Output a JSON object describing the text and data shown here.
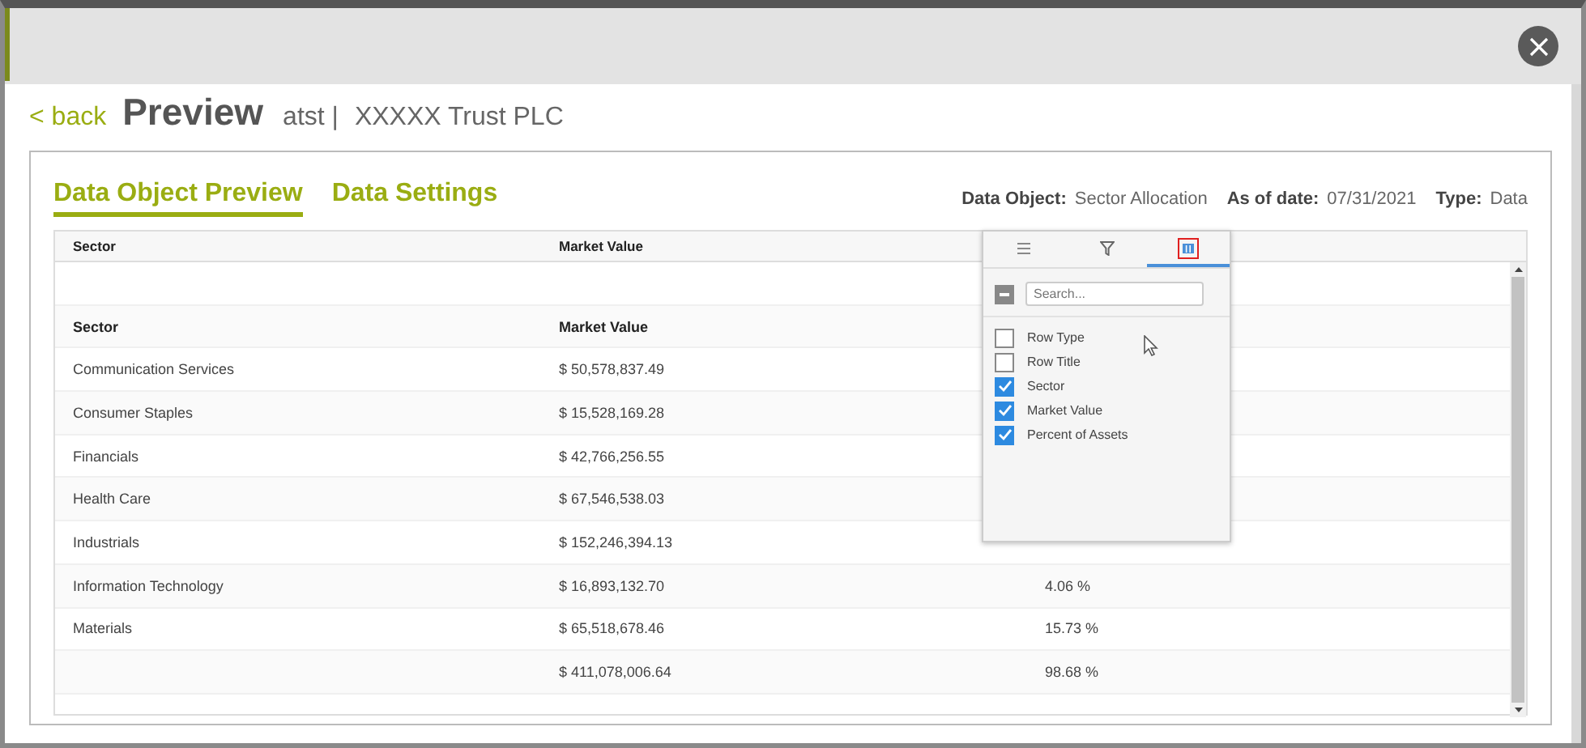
{
  "header": {
    "back": "< back",
    "title": "Preview",
    "subtitle": "atst |",
    "name": "XXXXX  Trust PLC"
  },
  "tabs": [
    {
      "label": "Data Object Preview",
      "selected": true
    },
    {
      "label": "Data Settings",
      "selected": false
    }
  ],
  "meta": [
    {
      "label": "Data Object:",
      "value": "Sector Allocation"
    },
    {
      "label": "As of date:",
      "value": "07/31/2021"
    },
    {
      "label": "Type:",
      "value": "Data"
    }
  ],
  "table": {
    "columns": [
      "Sector",
      "Market Value"
    ],
    "rows": [
      {
        "kind": "group_header",
        "sector": "Sector",
        "market_value": "Market Value"
      },
      {
        "kind": "data",
        "sector": "Communication Services",
        "market_value": "$ 50,578,837.49"
      },
      {
        "kind": "data",
        "sector": "Consumer Staples",
        "market_value": "$ 15,528,169.28"
      },
      {
        "kind": "data",
        "sector": "Financials",
        "market_value": "$ 42,766,256.55"
      },
      {
        "kind": "data",
        "sector": "Health Care",
        "market_value": "$ 67,546,538.03"
      },
      {
        "kind": "data",
        "sector": "Industrials",
        "market_value": "$ 152,246,394.13"
      },
      {
        "kind": "data",
        "sector": "Information Technology",
        "market_value": "$ 16,893,132.70",
        "percent": "4.06 %"
      },
      {
        "kind": "data",
        "sector": "Materials",
        "market_value": "$ 65,518,678.46",
        "percent": "15.73 %"
      },
      {
        "kind": "total",
        "market_value": "$ 411,078,006.64",
        "percent": "98.68 %"
      }
    ]
  },
  "column_menu": {
    "tabs": [
      {
        "kind": "menu",
        "selected": false
      },
      {
        "kind": "filter",
        "selected": false
      },
      {
        "kind": "columns",
        "selected": true
      }
    ],
    "select_all": {
      "indeterminate": true
    },
    "search": {
      "placeholder": "Search..."
    },
    "columns": [
      {
        "label": "Row Type",
        "checked": false
      },
      {
        "label": "Row Title",
        "checked": false
      },
      {
        "label": "Sector",
        "checked": true
      },
      {
        "label": "Market Value",
        "checked": true
      },
      {
        "label": "Percent of Assets",
        "checked": true
      }
    ]
  }
}
